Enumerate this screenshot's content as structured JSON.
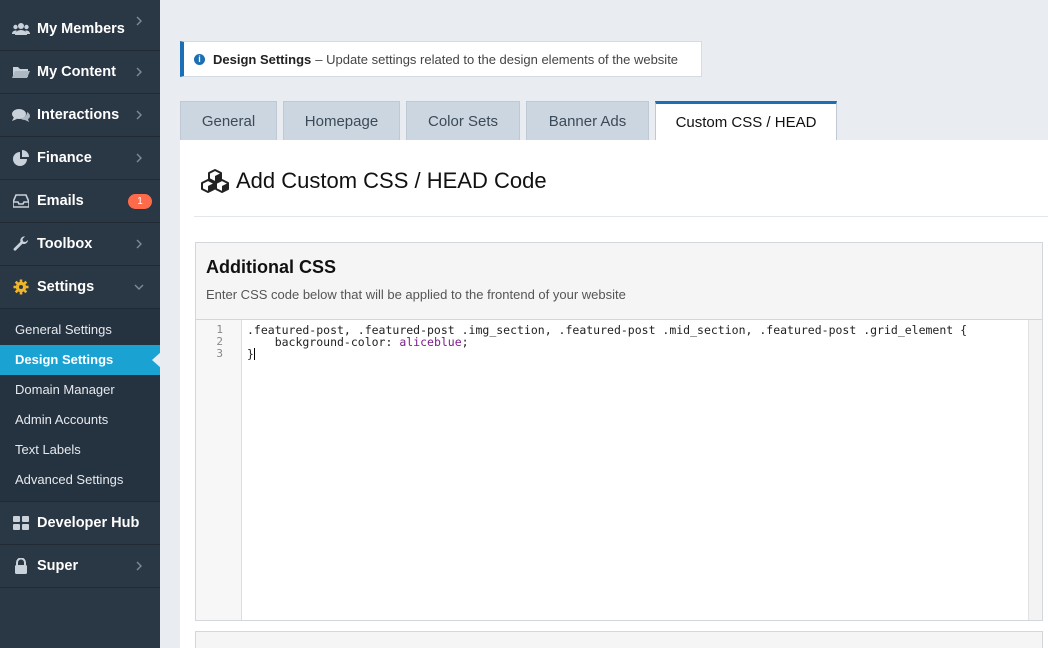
{
  "sidebar": {
    "items": [
      {
        "label": "My Members",
        "icon": "users-icon"
      },
      {
        "label": "My Content",
        "icon": "folder-icon"
      },
      {
        "label": "Interactions",
        "icon": "comments-icon"
      },
      {
        "label": "Finance",
        "icon": "pie-chart-icon"
      },
      {
        "label": "Emails",
        "icon": "inbox-icon",
        "badge": "1"
      },
      {
        "label": "Toolbox",
        "icon": "wrench-icon"
      },
      {
        "label": "Settings",
        "icon": "gear-icon"
      }
    ],
    "settings_sub": [
      {
        "label": "General Settings"
      },
      {
        "label": "Design Settings"
      },
      {
        "label": "Domain Manager"
      },
      {
        "label": "Admin Accounts"
      },
      {
        "label": "Text Labels"
      },
      {
        "label": "Advanced Settings"
      }
    ],
    "bottom_items": [
      {
        "label": "Developer Hub",
        "icon": "grid-icon"
      },
      {
        "label": "Super",
        "icon": "lock-icon"
      }
    ]
  },
  "alert": {
    "title": "Design Settings",
    "text": "– Update settings related to the design elements of the website"
  },
  "tabs": [
    {
      "label": "General"
    },
    {
      "label": "Homepage"
    },
    {
      "label": "Color Sets"
    },
    {
      "label": "Banner Ads"
    },
    {
      "label": "Custom CSS / HEAD"
    }
  ],
  "page_title": "Add Custom CSS / HEAD Code",
  "css_card": {
    "title": "Additional CSS",
    "description": "Enter CSS code below that will be applied to the frontend of your website",
    "line_numbers": [
      "1",
      "2",
      "3"
    ],
    "code": {
      "line1": ".featured-post, .featured-post .img_section, .featured-post .mid_section, .featured-post .grid_element {",
      "line2_prop": "    background-color: ",
      "line2_value": "aliceblue",
      "line2_end": ";",
      "line3": "}"
    }
  },
  "colors": {
    "sidebar_bg": "#2a3744",
    "active_item": "#1aa2d3",
    "accent_blue": "#1a6fb5",
    "badge": "#ff6b4a"
  }
}
